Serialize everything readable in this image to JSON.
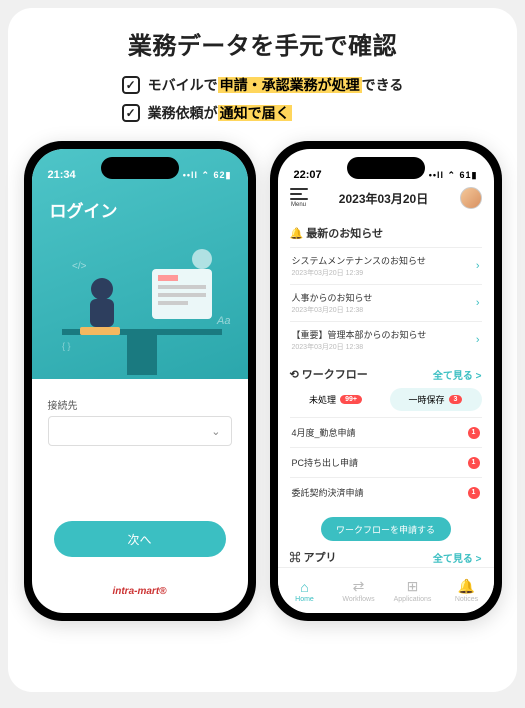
{
  "headline": "業務データを手元で確認",
  "bullets": [
    {
      "pre": "モバイルで",
      "hl": "申請・承認業務が処理",
      "post": "できる"
    },
    {
      "pre": "業務依頼が",
      "hl": "通知で届く",
      "post": ""
    }
  ],
  "phone_left": {
    "time": "21:34",
    "signal": "••ll ⌃ 62▮",
    "title": "ログイン",
    "conn_label": "接続先",
    "next": "次へ",
    "brand": "intra-mart®"
  },
  "phone_right": {
    "time": "22:07",
    "signal": "••ll ⌃ 61▮",
    "menu_label": "Menu",
    "date": "2023年03月20日",
    "notice_h": "🔔 最新のお知らせ",
    "notices": [
      {
        "title": "システムメンテナンスのお知らせ",
        "date": "2023年03月20日 12:39"
      },
      {
        "title": "人事からのお知らせ",
        "date": "2023年03月20日 12:38"
      },
      {
        "title": "【重要】管理本部からのお知らせ",
        "date": "2023年03月20日 12:38"
      }
    ],
    "wf_h": "⟲ ワークフロー",
    "view_all": "全て見る >",
    "tabs": [
      {
        "label": "未処理",
        "badge": "99+",
        "active": false
      },
      {
        "label": "一時保存",
        "badge": "3",
        "active": true
      }
    ],
    "wf_items": [
      {
        "label": "4月度_勤怠申請",
        "count": "1"
      },
      {
        "label": "PC持ち出し申請",
        "count": "1"
      },
      {
        "label": "委託契約決済申請",
        "count": "1"
      }
    ],
    "apply": "ワークフローを申請する",
    "app_h": "⌘ アプリ",
    "tabbar": [
      {
        "icon": "⌂",
        "label": "Home",
        "on": true
      },
      {
        "icon": "⇄",
        "label": "Workflows",
        "on": false
      },
      {
        "icon": "⊞",
        "label": "Applications",
        "on": false
      },
      {
        "icon": "🔔",
        "label": "Notices",
        "on": false
      }
    ]
  }
}
